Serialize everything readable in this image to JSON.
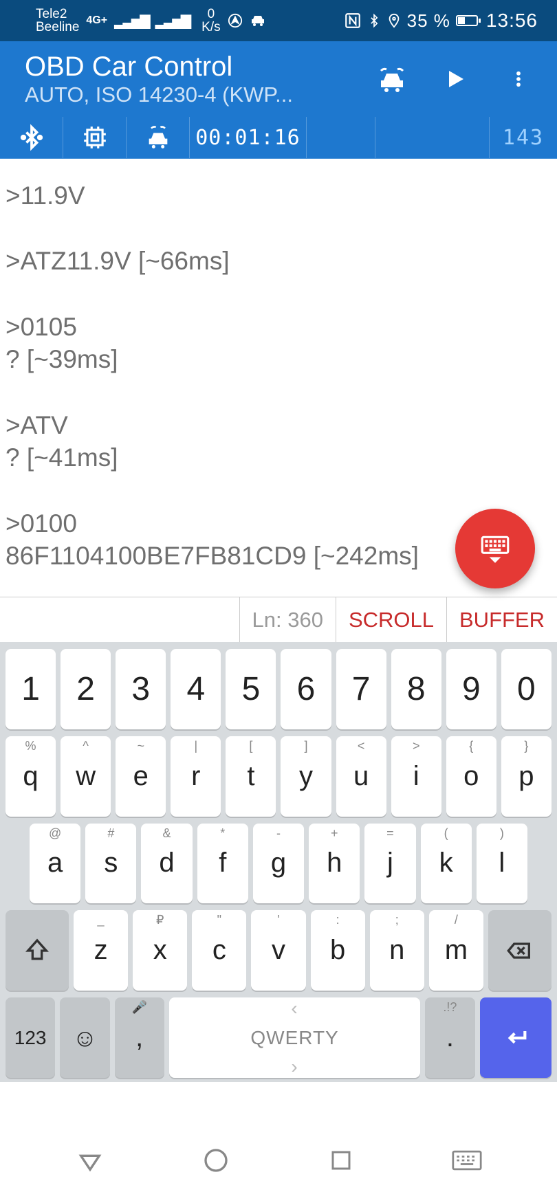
{
  "statusbar": {
    "carrier1": "Tele2",
    "carrier2": "Beeline",
    "net_type": "4G+",
    "speed_num": "0",
    "speed_unit": "K/s",
    "battery_pct": "35 %",
    "time": "13:56"
  },
  "appbar": {
    "title": "OBD Car Control",
    "subtitle": "AUTO, ISO 14230-4 (KWP..."
  },
  "toolstrip": {
    "elapsed": "00:01:16",
    "counter": "143"
  },
  "terminal_text": ">11.9V\n\n>ATZ11.9V [~66ms]\n\n>0105\n? [~39ms]\n\n>ATV\n? [~41ms]\n\n>0100\n86F1104100BE7FB81CD9 [~242ms]\n\n>",
  "bufbar": {
    "line": "Ln: 360",
    "scroll": "SCROLL",
    "buffer": "BUFFER"
  },
  "keyboard": {
    "row1": [
      "1",
      "2",
      "3",
      "4",
      "5",
      "6",
      "7",
      "8",
      "9",
      "0"
    ],
    "row2": [
      {
        "main": "q",
        "alt": "%"
      },
      {
        "main": "w",
        "alt": "^"
      },
      {
        "main": "e",
        "alt": "~"
      },
      {
        "main": "r",
        "alt": "|"
      },
      {
        "main": "t",
        "alt": "["
      },
      {
        "main": "y",
        "alt": "]"
      },
      {
        "main": "u",
        "alt": "<"
      },
      {
        "main": "i",
        "alt": ">"
      },
      {
        "main": "o",
        "alt": "{"
      },
      {
        "main": "p",
        "alt": "}"
      }
    ],
    "row3": [
      {
        "main": "a",
        "alt": "@"
      },
      {
        "main": "s",
        "alt": "#"
      },
      {
        "main": "d",
        "alt": "&"
      },
      {
        "main": "f",
        "alt": "*"
      },
      {
        "main": "g",
        "alt": "-"
      },
      {
        "main": "h",
        "alt": "+"
      },
      {
        "main": "j",
        "alt": "="
      },
      {
        "main": "k",
        "alt": "("
      },
      {
        "main": "l",
        "alt": ")"
      }
    ],
    "row4": [
      {
        "main": "z",
        "alt": "_"
      },
      {
        "main": "x",
        "alt": "₽"
      },
      {
        "main": "c",
        "alt": "\""
      },
      {
        "main": "v",
        "alt": "'"
      },
      {
        "main": "b",
        "alt": ":"
      },
      {
        "main": "n",
        "alt": ";"
      },
      {
        "main": "m",
        "alt": "/"
      }
    ],
    "row5": {
      "mode": "123",
      "emoji": "☺",
      "comma": ",",
      "space_label": "QWERTY",
      "period": ".",
      "period_alt": ".!?"
    }
  }
}
